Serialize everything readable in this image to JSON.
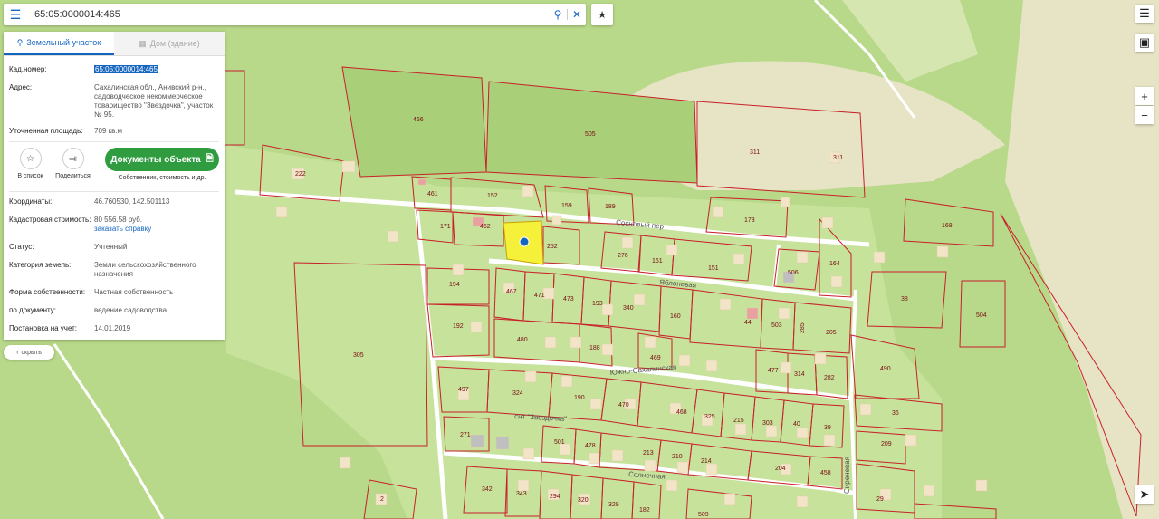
{
  "search": {
    "value": "65:05:0000014:465"
  },
  "panel": {
    "tabs": [
      {
        "label": "Земельный участок"
      },
      {
        "label": "Дом (здание)"
      }
    ],
    "cad_number": {
      "key": "Кад.номер:",
      "value": "65:05:0000014:465"
    },
    "address": {
      "key": "Адрес:",
      "value": "Сахалинская обл., Анивский р-н., садоводческое некоммерческое товарищество \"Звездочка\", участок № 95."
    },
    "area": {
      "key": "Уточненная площадь:",
      "value": "709 кв.м"
    },
    "actions": {
      "add_list": "В список",
      "share": "Поделиться",
      "docs": "Документы объекта",
      "docs_sub": "Собственник, стоимость и др."
    },
    "coords": {
      "key": "Координаты:",
      "value": "46.760530, 142.501113"
    },
    "cad_cost": {
      "key": "Кадастровая стоимость:",
      "value": "80 556.58 руб.",
      "link": "заказать справку"
    },
    "status": {
      "key": "Статус:",
      "value": "Учтенный"
    },
    "land_cat": {
      "key": "Категория земель:",
      "value": "Земли сельскохозяйственного назначения"
    },
    "ownership": {
      "key": "Форма собственности:",
      "value": "Частная собственность"
    },
    "by_doc": {
      "key": "по документу:",
      "value": "ведение садоводства"
    },
    "registered": {
      "key": "Постановка на учет:",
      "value": "14.01.2019"
    }
  },
  "hide_label": "скрыть",
  "map": {
    "streets": [
      "Сосновый пер",
      "Яблоневая",
      "Южно-Сахалинская",
      "снт \"Звездочка\"",
      "Солнечная",
      "Сиреневая"
    ],
    "plots": [
      "466",
      "505",
      "311",
      "311",
      "222",
      "461",
      "152",
      "159",
      "189",
      "173",
      "168",
      "462",
      "171",
      "252",
      "276",
      "161",
      "151",
      "506",
      "164",
      "467",
      "471",
      "473",
      "193",
      "340",
      "160",
      "44",
      "503",
      "285",
      "205",
      "38",
      "504",
      "305",
      "194",
      "192",
      "480",
      "188",
      "469",
      "477",
      "314",
      "282",
      "490",
      "497",
      "324",
      "190",
      "470",
      "468",
      "325",
      "215",
      "303",
      "40",
      "39",
      "36",
      "271",
      "501",
      "478",
      "213",
      "210",
      "214",
      "204",
      "458",
      "209",
      "342",
      "343",
      "294",
      "320",
      "329",
      "182",
      "509",
      "29",
      "2"
    ]
  },
  "colors": {
    "accent": "#1565c0",
    "docs_button": "#2e9c3f",
    "plot_border": "#c8202a",
    "selected_plot": "#f5f03a"
  }
}
